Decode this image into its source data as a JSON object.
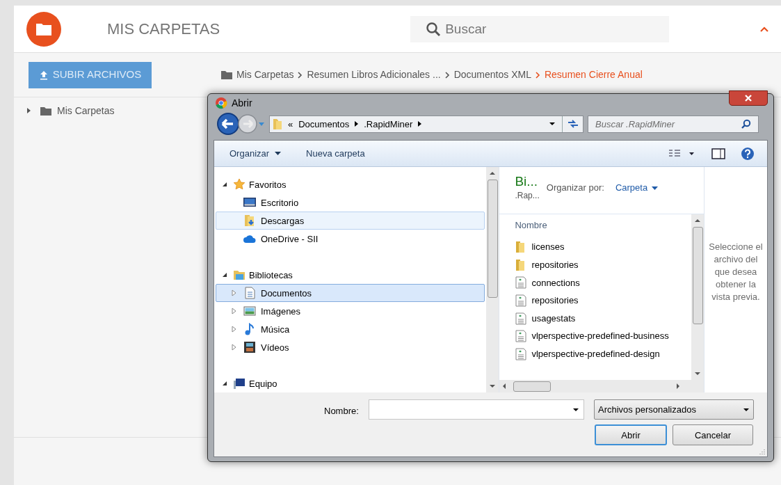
{
  "app": {
    "title": "MIS CARPETAS",
    "search": {
      "placeholder": "Buscar"
    },
    "upload_button": "SUBIR ARCHIVOS",
    "breadcrumb": [
      {
        "label": "Mis Carpetas",
        "current": false
      },
      {
        "label": "Resumen Libros Adicionales ...",
        "current": false
      },
      {
        "label": "Documentos XML",
        "current": false
      },
      {
        "label": "Resumen Cierre Anual",
        "current": true
      }
    ],
    "tree": [
      {
        "label": "Mis Carpetas",
        "expanded": false
      }
    ]
  },
  "dialog": {
    "title": "Abrir",
    "address": [
      "Documentos",
      ".RapidMiner"
    ],
    "address_prefix": "«",
    "search": {
      "placeholder": "Buscar .RapidMiner"
    },
    "toolbar": [
      {
        "label": "Organizar",
        "menu": true
      },
      {
        "label": "Nueva carpeta",
        "menu": false
      }
    ],
    "nav": [
      {
        "label": "Favoritos",
        "kind": "star",
        "expanded": true,
        "children": [
          {
            "label": "Escritorio",
            "kind": "desktop",
            "selected": false,
            "hovered": false
          },
          {
            "label": "Descargas",
            "kind": "downloads",
            "selected": false,
            "hovered": true
          },
          {
            "label": "OneDrive - SII",
            "kind": "cloud",
            "selected": false,
            "hovered": false
          }
        ]
      },
      {
        "label": "Bibliotecas",
        "kind": "library",
        "expanded": true,
        "children": [
          {
            "label": "Documentos",
            "kind": "document",
            "selected": true,
            "hovered": false,
            "expanded": false
          },
          {
            "label": "Imágenes",
            "kind": "image",
            "selected": false,
            "hovered": false,
            "expanded": false
          },
          {
            "label": "Música",
            "kind": "music",
            "selected": false,
            "hovered": false,
            "expanded": false
          },
          {
            "label": "Vídeos",
            "kind": "video",
            "selected": false,
            "hovered": false,
            "expanded": false
          }
        ]
      },
      {
        "label": "Equipo",
        "kind": "computer",
        "expanded": true
      }
    ],
    "library": {
      "title": "Bi...",
      "subtitle": ".Rap...",
      "arrange_label": "Organizar por:",
      "arrange_value": "Carpeta"
    },
    "column": "Nombre",
    "files": [
      {
        "kind": "folder",
        "name": "licenses"
      },
      {
        "kind": "folder",
        "name": "repositories"
      },
      {
        "kind": "file",
        "name": "connections"
      },
      {
        "kind": "file",
        "name": "repositories"
      },
      {
        "kind": "file",
        "name": "usagestats"
      },
      {
        "kind": "file",
        "name": "vlperspective-predefined-business"
      },
      {
        "kind": "file",
        "name": "vlperspective-predefined-design"
      }
    ],
    "preview_text": "Seleccione el archivo del que desea obtener la vista previa.",
    "filename_label": "Nombre:",
    "file_type": "Archivos personalizados",
    "buttons": [
      {
        "label": "Abrir",
        "default": true
      },
      {
        "label": "Cancelar",
        "default": false
      }
    ]
  }
}
